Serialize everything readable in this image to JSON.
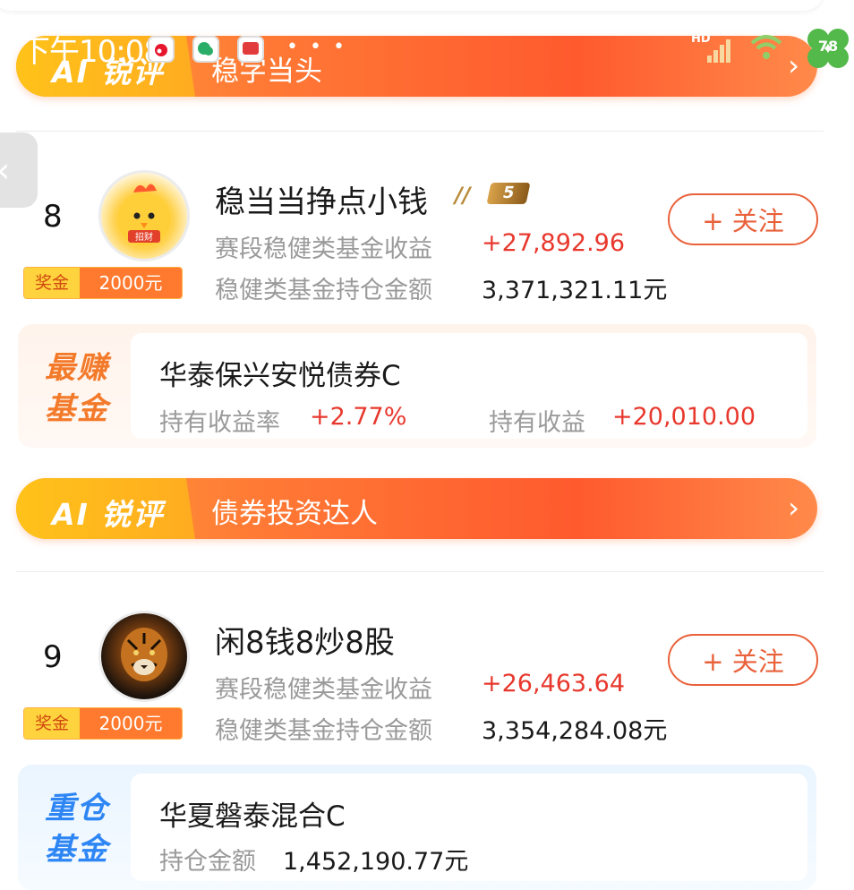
{
  "status_bar": {
    "time": "下午10:08",
    "dots": "• • •",
    "hd": "HD",
    "battery": "78"
  },
  "banners": [
    {
      "tag": "AI 锐评",
      "text": "稳字当头"
    },
    {
      "tag": "AI 锐评",
      "text": "债券投资达人"
    }
  ],
  "chevron": "›",
  "back_glyph": "‹",
  "users": [
    {
      "rank": "8",
      "avatar_badge": "招财",
      "prize_label": "奖金",
      "prize_value": "2000元",
      "name": "稳当当挣点小钱",
      "level": "5",
      "stat1_label": "赛段稳健类基金收益",
      "stat1_value": "+27,892.96",
      "stat2_label": "稳健类基金持仓金额",
      "stat2_value": "3,371,321.11元",
      "follow_label": "+ 关注",
      "fund": {
        "tag_line1": "最赚",
        "tag_line2": "基金",
        "name": "华泰保兴安悦债券C",
        "m1_label": "持有收益率",
        "m1_value": "+2.77%",
        "m2_label": "持有收益",
        "m2_value": "+20,010.00"
      }
    },
    {
      "rank": "9",
      "prize_label": "奖金",
      "prize_value": "2000元",
      "name": "闲8钱8炒8股",
      "stat1_label": "赛段稳健类基金收益",
      "stat1_value": "+26,463.64",
      "stat2_label": "稳健类基金持仓金额",
      "stat2_value": "3,354,284.08元",
      "follow_label": "+ 关注",
      "fund": {
        "tag_line1": "重仓",
        "tag_line2": "基金",
        "name": "华夏磐泰混合C",
        "m1_label": "持仓金额",
        "m1_value": "1,452,190.77元"
      }
    }
  ],
  "colors": {
    "accent": "#ff5a2e",
    "red": "#e8382d",
    "follow": "#e9613a",
    "blue_tag": "#2e86f5",
    "orange_tag": "#f37a2a"
  }
}
